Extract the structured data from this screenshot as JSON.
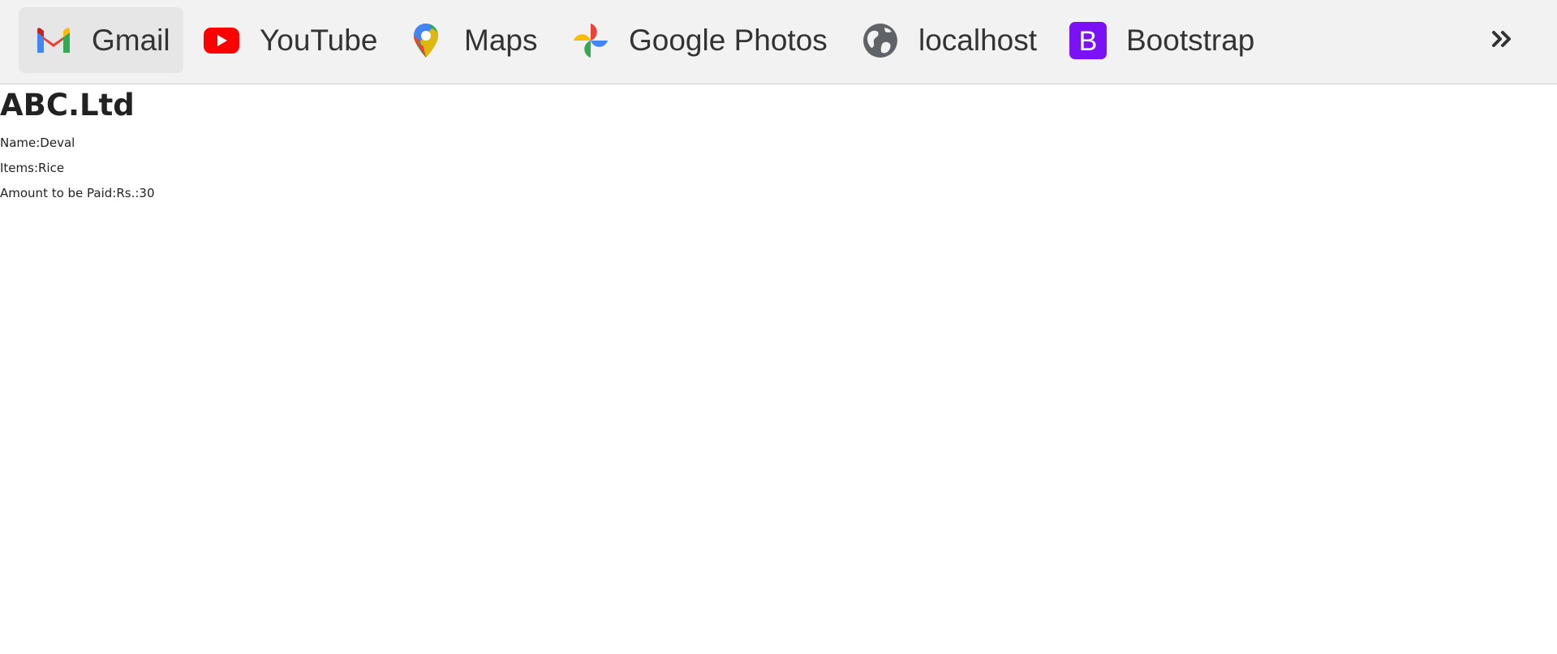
{
  "bookmarks": {
    "items": [
      {
        "label": "Gmail",
        "icon": "gmail-icon"
      },
      {
        "label": "YouTube",
        "icon": "youtube-icon"
      },
      {
        "label": "Maps",
        "icon": "maps-icon"
      },
      {
        "label": "Google Photos",
        "icon": "google-photos-icon"
      },
      {
        "label": "localhost",
        "icon": "globe-icon"
      },
      {
        "label": "Bootstrap",
        "icon": "bootstrap-icon"
      }
    ],
    "overflow_icon": "double-chevron-right-icon"
  },
  "page": {
    "company": "ABC.Ltd",
    "name_line": "Name:Deval",
    "items_line": "Items:Rice",
    "amount_line": "Amount to be Paid:Rs.:30"
  },
  "colors": {
    "bar_background": "#f2f2f2",
    "youtube_red": "#ff0000",
    "bootstrap_purple": "#7a12f5",
    "globe_gray": "#5f6368"
  }
}
